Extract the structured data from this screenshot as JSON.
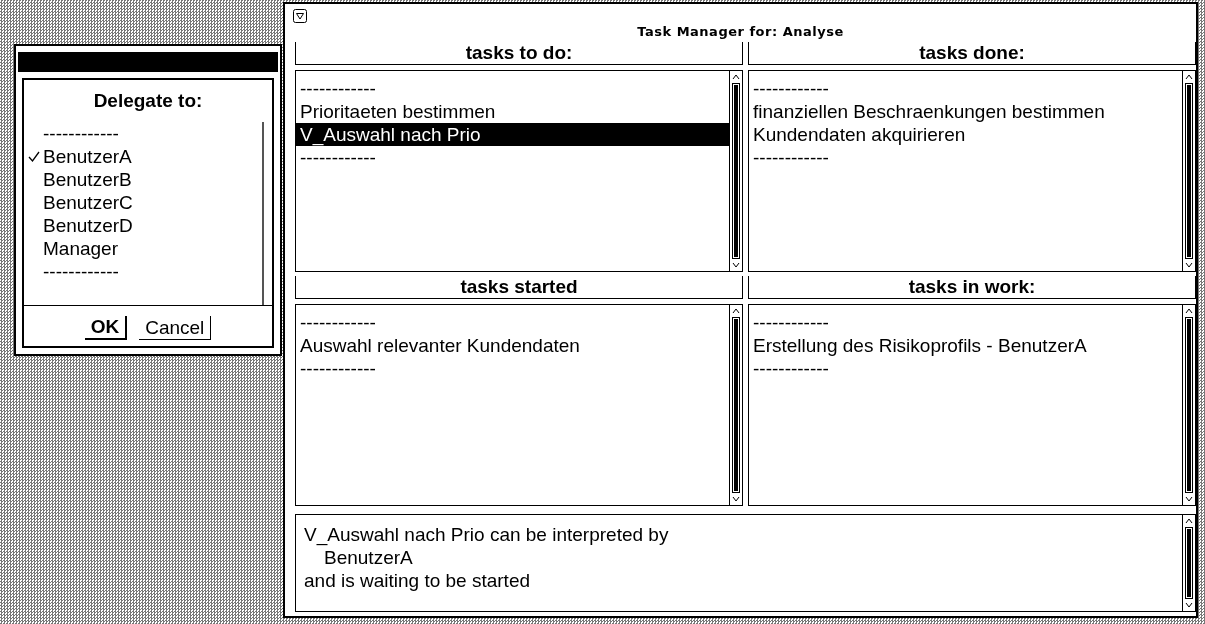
{
  "dialog": {
    "title": "Delegate to:",
    "items": [
      {
        "label": "------------",
        "checked": false
      },
      {
        "label": "BenutzerA",
        "checked": true
      },
      {
        "label": "BenutzerB",
        "checked": false
      },
      {
        "label": "BenutzerC",
        "checked": false
      },
      {
        "label": "BenutzerD",
        "checked": false
      },
      {
        "label": "Manager",
        "checked": false
      },
      {
        "label": "------------",
        "checked": false
      }
    ],
    "buttons": [
      {
        "label": "OK",
        "default": true
      },
      {
        "label": "Cancel",
        "default": false
      }
    ]
  },
  "window": {
    "title": "Task Manager for: Analyse"
  },
  "panels": [
    {
      "title": "tasks to do:",
      "items": [
        {
          "label": "------------",
          "selected": false
        },
        {
          "label": "Prioritaeten bestimmen",
          "selected": false
        },
        {
          "label": "V_Auswahl nach Prio",
          "selected": true
        },
        {
          "label": "------------",
          "selected": false
        }
      ]
    },
    {
      "title": "tasks done:",
      "items": [
        {
          "label": "------------",
          "selected": false
        },
        {
          "label": "finanziellen Beschraenkungen bestimmen",
          "selected": false
        },
        {
          "label": "Kundendaten akquirieren",
          "selected": false
        },
        {
          "label": "------------",
          "selected": false
        }
      ]
    },
    {
      "title": "tasks started",
      "items": [
        {
          "label": "------------",
          "selected": false
        },
        {
          "label": "Auswahl relevanter Kundendaten",
          "selected": false
        },
        {
          "label": "------------",
          "selected": false
        }
      ]
    },
    {
      "title": "tasks in work:",
      "items": [
        {
          "label": "------------",
          "selected": false
        },
        {
          "label": "Erstellung des Risikoprofils - BenutzerA",
          "selected": false
        },
        {
          "label": "------------",
          "selected": false
        }
      ]
    }
  ],
  "message": {
    "lines": [
      {
        "text": "V_Auswahl nach Prio can be interpreted by",
        "indented": false
      },
      {
        "text": "BenutzerA",
        "indented": true
      },
      {
        "text": "and is waiting to be started",
        "indented": false
      }
    ]
  }
}
